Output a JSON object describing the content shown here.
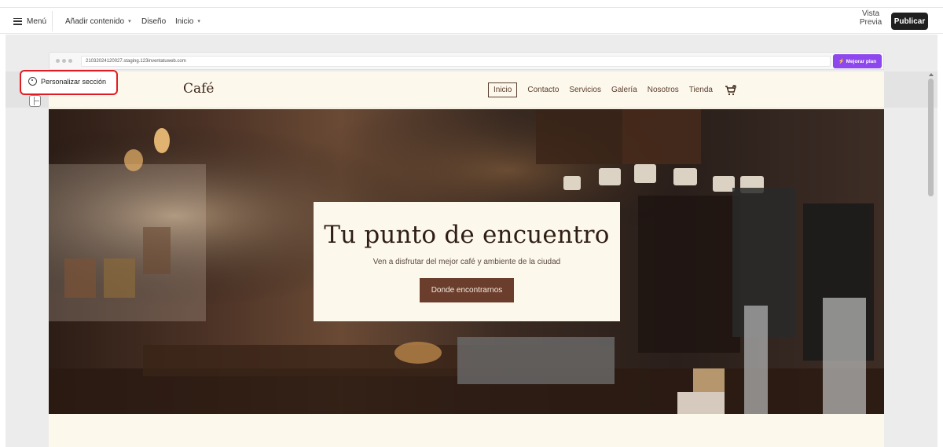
{
  "toolbar": {
    "menu_label": "Menú",
    "add_content_label": "Añadir contenido",
    "design_label": "Diseño",
    "home_label": "Inicio",
    "preview_label_1": "Vista",
    "preview_label_2": "Previa",
    "publish_label": "Publicar"
  },
  "browser": {
    "url": "21032024120027.staging.123inventatuweb.com",
    "upgrade_label": "⚡ Mejorar plan"
  },
  "section_tools": {
    "customize_label": "Personalizar sección"
  },
  "site": {
    "logo": "Café",
    "nav": [
      "Inicio",
      "Contacto",
      "Servicios",
      "Galería",
      "Nosotros",
      "Tienda"
    ],
    "cart_count": "0"
  },
  "hero": {
    "title": "Tu punto de encuentro",
    "subtitle": "Ven a disfrutar del mejor café y ambiente de la ciudad",
    "button_label": "Donde encontrarnos"
  },
  "colors": {
    "publish": "#1f1f1f",
    "upgrade": "#8e46ee",
    "highlight": "#e01d23",
    "site_bg": "#fdf8ec",
    "cta": "#6b3d2c"
  }
}
